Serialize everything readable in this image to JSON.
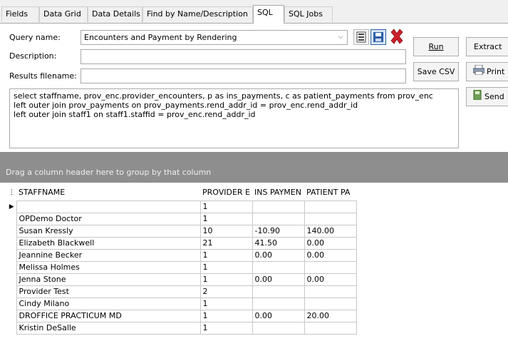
{
  "tabs": [
    "Fields",
    "Data Grid",
    "Data Details",
    "Find by Name/Description",
    "SQL",
    "SQL Jobs"
  ],
  "form": {
    "query_name_label": "Query name:",
    "query_name_value": "Encounters and Payment by Rendering",
    "description_label": "Description:",
    "description_value": "",
    "results_filename_label": "Results filename:",
    "results_filename_value": ""
  },
  "buttons": {
    "run": "Run",
    "extract": "Extract",
    "save_csv": "Save CSV",
    "print": "Print",
    "send": "Send"
  },
  "sql_text": "select staffname, prov_enc.provider_encounters, p as ins_payments, c as patient_payments from prov_enc\nleft outer join prov_payments on prov_payments.rend_addr_id = prov_enc.rend_addr_id\nleft outer join staff1 on staff1.staffid = prov_enc.rend_addr_id",
  "group_hint": "Drag a column header here to group by that column",
  "grid": {
    "columns": [
      "STAFFNAME",
      "PROVIDER E",
      "INS PAYMEN",
      "PATIENT PA"
    ],
    "rows": [
      [
        "",
        "1",
        "",
        ""
      ],
      [
        "OPDemo Doctor",
        "1",
        "",
        ""
      ],
      [
        "Susan Kressly",
        "10",
        "-10.90",
        "140.00"
      ],
      [
        "Elizabeth Blackwell",
        "21",
        "41.50",
        "0.00"
      ],
      [
        "Jeannine Becker",
        "1",
        "0.00",
        "0.00"
      ],
      [
        "Melissa Holmes",
        "1",
        "",
        ""
      ],
      [
        "Jenna Stone",
        "1",
        "0.00",
        "0.00"
      ],
      [
        "Provider Test",
        "2",
        "",
        ""
      ],
      [
        "Cindy Milano",
        "1",
        "",
        ""
      ],
      [
        "DROFFICE PRACTICUM MD",
        "1",
        "0.00",
        "20.00"
      ],
      [
        "Kristin DeSalle",
        "1",
        "",
        ""
      ]
    ]
  },
  "icons": {
    "save": "save-icon",
    "save_as": "save-as-icon",
    "delete": "delete-icon",
    "print": "printer-icon",
    "send": "send-icon",
    "row_indicator": "row-pointer-icon",
    "column_chooser": "column-chooser-icon"
  },
  "colors": {
    "delete_icon": "#d0202a",
    "group_bar": "#8e8e8e",
    "save_icon": "#2a5fa8"
  }
}
